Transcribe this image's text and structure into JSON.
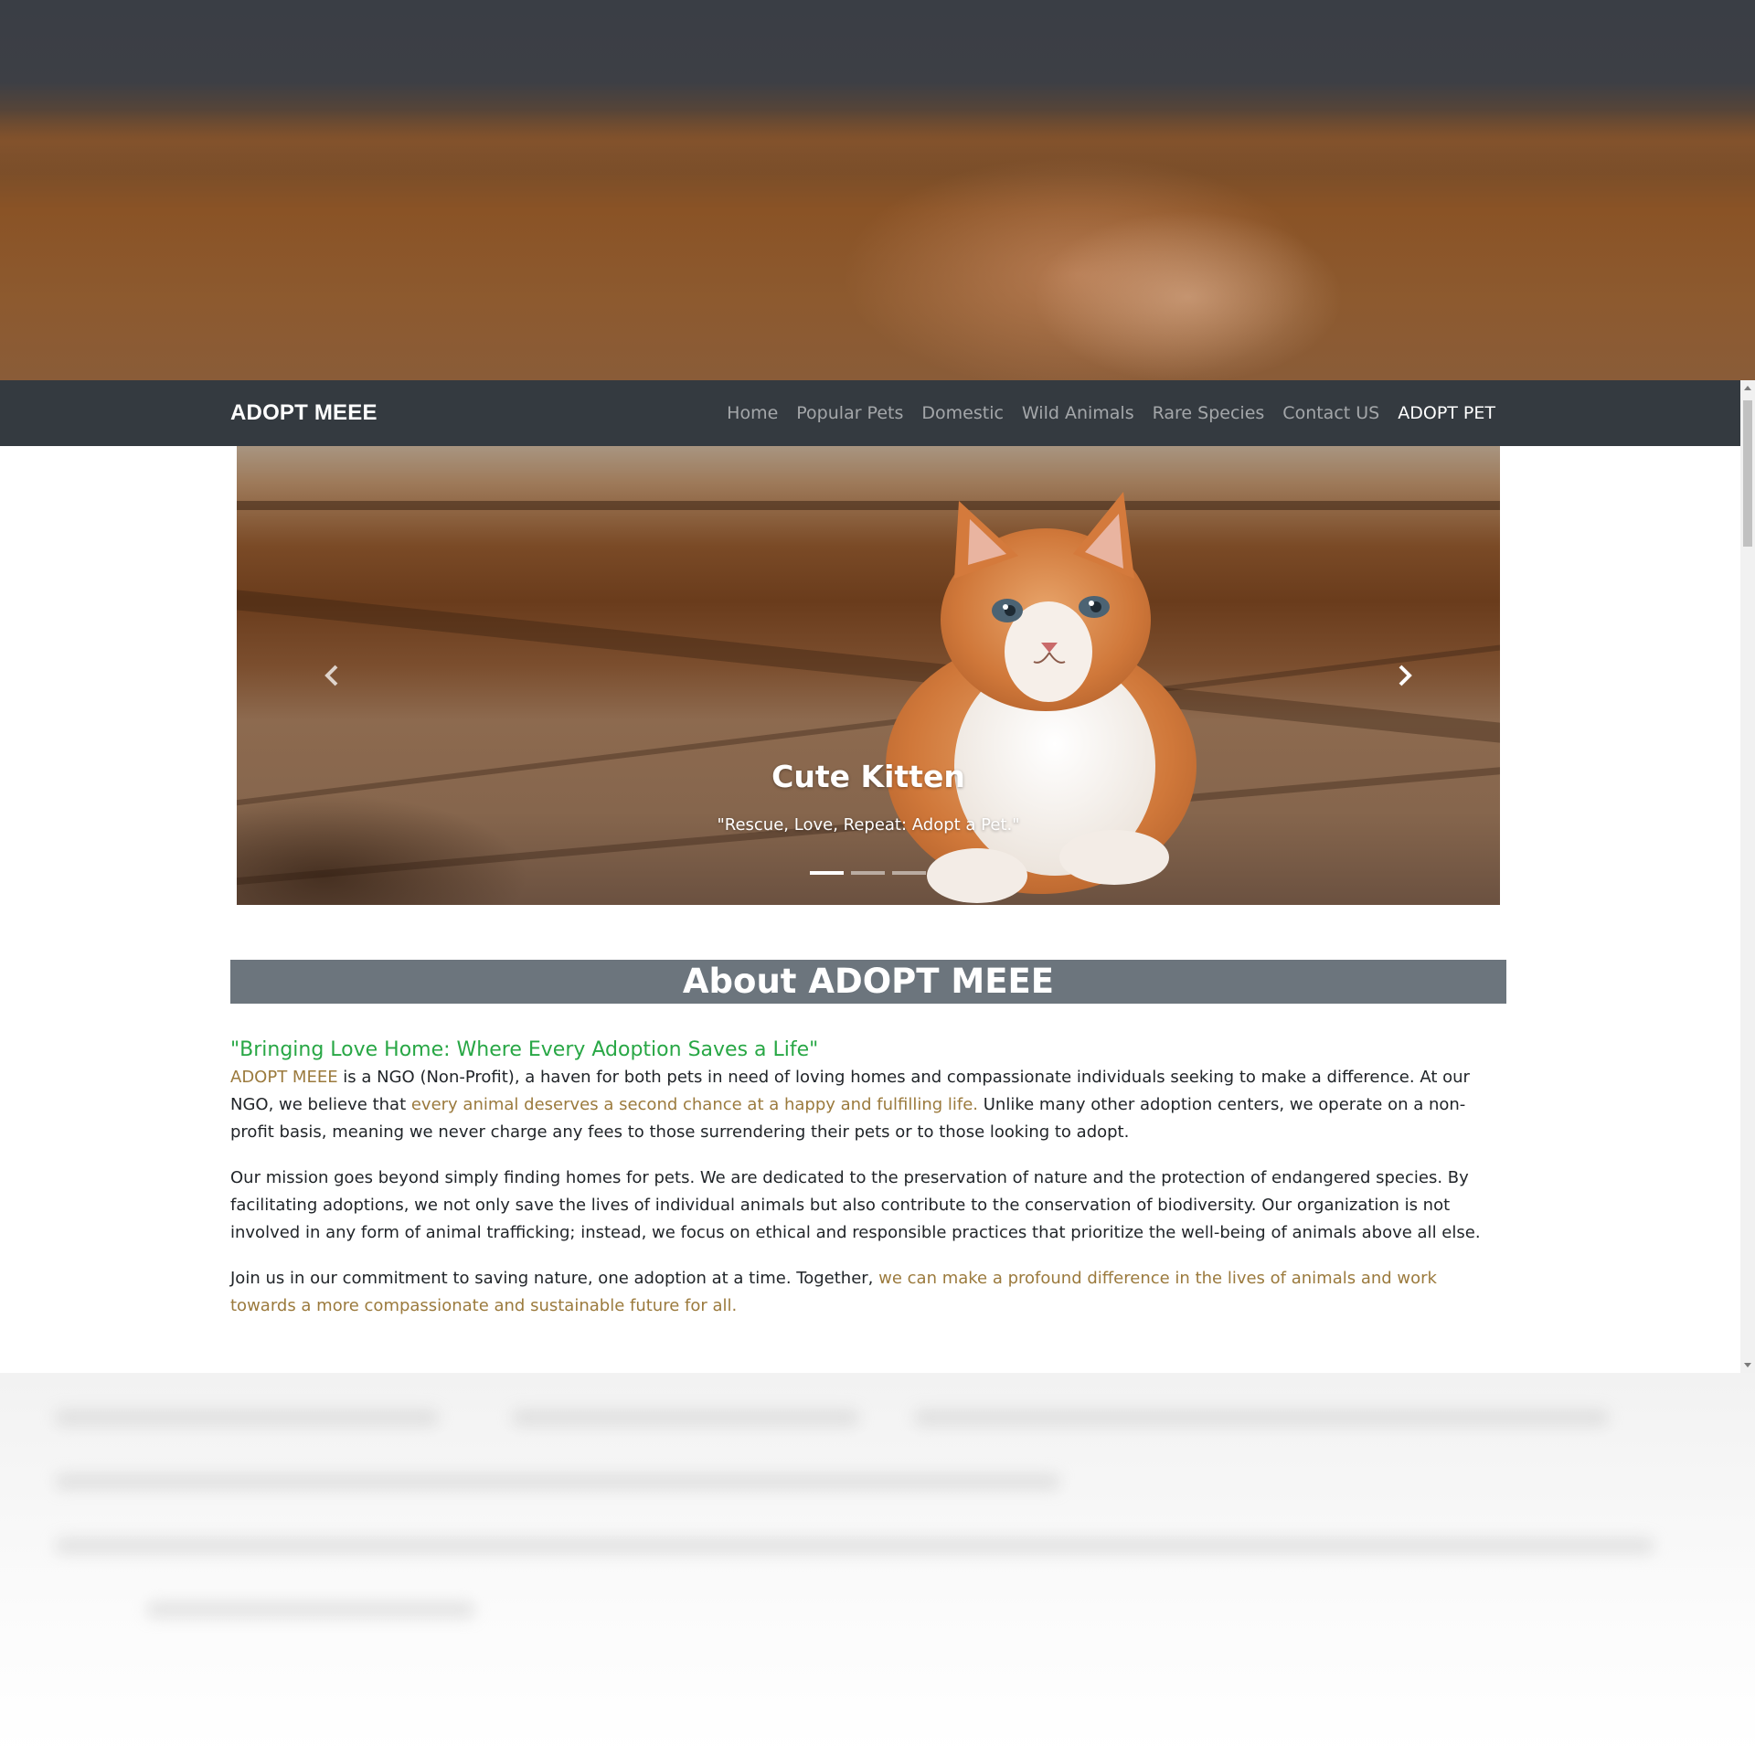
{
  "navbar": {
    "brand": "ADOPT MEEE",
    "links": [
      "Home",
      "Popular Pets",
      "Domestic",
      "Wild Animals",
      "Rare Species",
      "Contact US",
      "ADOPT PET"
    ],
    "active_link": "ADOPT PET"
  },
  "carousel": {
    "title": "Cute Kitten",
    "subtitle": "\"Rescue, Love, Repeat: Adopt a Pet.\"",
    "slide_count": 3,
    "active_slide": 1,
    "prev_icon": "chevron-left-icon",
    "next_icon": "chevron-right-icon"
  },
  "about": {
    "heading": "About ADOPT MEEE",
    "tagline": "\"Bringing Love Home: Where Every Adoption Saves a Life\"",
    "p1": {
      "brand": "ADOPT MEEE",
      "a": " is a NGO (Non-Profit), a haven for both pets in need of loving homes and compassionate individuals seeking to make a difference. At our NGO, we believe that ",
      "highlight": "every animal deserves a second chance at a happy and fulfilling life.",
      "b": " Unlike many other adoption centers, we operate on a non-profit basis, meaning we never charge any fees to those surrendering their pets or to those looking to adopt."
    },
    "p2": "Our mission goes beyond simply finding homes for pets. We are dedicated to the preservation of nature and the protection of endangered species. By facilitating adoptions, we not only save the lives of individual animals but also contribute to the conservation of biodiversity. Our organization is not involved in any form of animal trafficking; instead, we focus on ethical and responsible practices that prioritize the well-being of animals above all else.",
    "p3": {
      "a": "Join us in our commitment to saving nature, one adoption at a time. Together, ",
      "highlight": "we can make a profound difference in the lives of animals and work towards a more compassionate and sustainable future for all."
    }
  },
  "colors": {
    "navbar_bg": "#343a40",
    "heading_bg": "#6c757d",
    "tagline": "#28a745",
    "highlight": "#9b7a3d"
  }
}
